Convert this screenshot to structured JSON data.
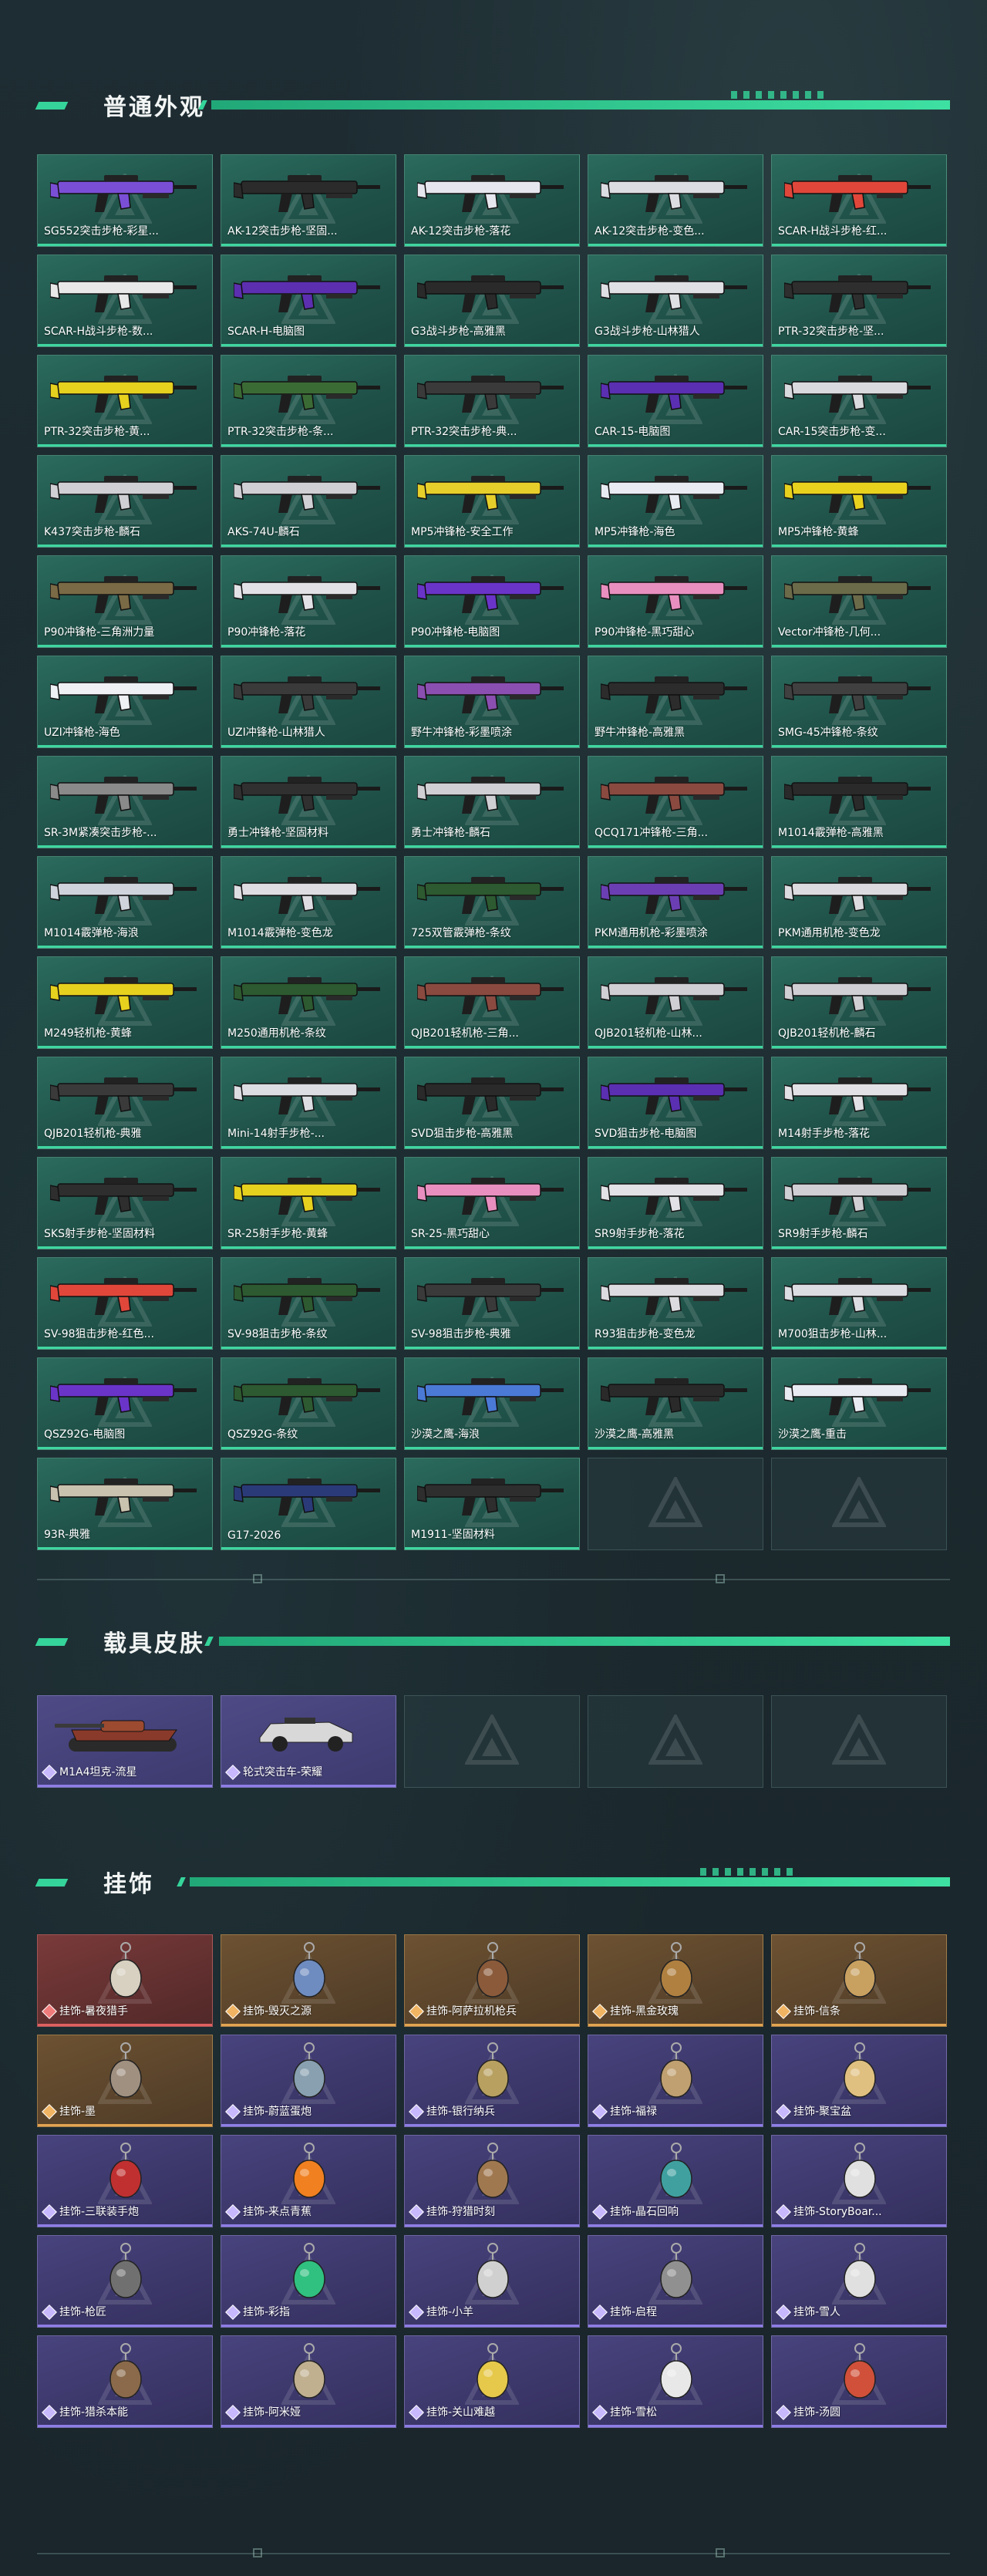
{
  "sections": {
    "weapons_title": "普通外观",
    "vehicles_title": "载具皮肤",
    "charms_title": "挂饰"
  },
  "weapons": [
    {
      "label": "SG552突击步枪-彩星...",
      "color": "#7a4fd6"
    },
    {
      "label": "AK-12突击步枪-坚固...",
      "color": "#2b2b2b"
    },
    {
      "label": "AK-12突击步枪-落花",
      "color": "#e6e6ee"
    },
    {
      "label": "AK-12突击步枪-变色...",
      "color": "#dcdde2"
    },
    {
      "label": "SCAR-H战斗步枪-红...",
      "color": "#e0473a"
    },
    {
      "label": "SCAR-H战斗步枪-数...",
      "color": "#e8e8e8"
    },
    {
      "label": "SCAR-H-电脑图",
      "color": "#5b2fb0"
    },
    {
      "label": "G3战斗步枪-高雅黑",
      "color": "#2a2a2a"
    },
    {
      "label": "G3战斗步枪-山林猎人",
      "color": "#dfe0e4"
    },
    {
      "label": "PTR-32突击步枪-坚...",
      "color": "#2e2e2e"
    },
    {
      "label": "PTR-32突击步枪-黄...",
      "color": "#e5d11e"
    },
    {
      "label": "PTR-32突击步枪-条...",
      "color": "#3b6b35"
    },
    {
      "label": "PTR-32突击步枪-典...",
      "color": "#3a3a3a"
    },
    {
      "label": "CAR-15-电脑图",
      "color": "#5a2fb2"
    },
    {
      "label": "CAR-15突击步枪-变...",
      "color": "#d9dade"
    },
    {
      "label": "K437突击步枪-麟石",
      "color": "#cfcfd4"
    },
    {
      "label": "AKS-74U-麟石",
      "color": "#cfcfd4"
    },
    {
      "label": "MP5冲锋枪-安全工作",
      "color": "#e6cf2a"
    },
    {
      "label": "MP5冲锋枪-海色",
      "color": "#e8ecf2"
    },
    {
      "label": "MP5冲锋枪-黄蜂",
      "color": "#e8d21e"
    },
    {
      "label": "P90冲锋枪-三角洲力量",
      "color": "#7a6a45"
    },
    {
      "label": "P90冲锋枪-落花",
      "color": "#e2e2e6"
    },
    {
      "label": "P90冲锋枪-电脑图",
      "color": "#6a34c9"
    },
    {
      "label": "P90冲锋枪-黑巧甜心",
      "color": "#e88fbf"
    },
    {
      "label": "Vector冲锋枪-几何...",
      "color": "#6b6b4a"
    },
    {
      "label": "UZI冲锋枪-海色",
      "color": "#eef0f4"
    },
    {
      "label": "UZI冲锋枪-山林猎人",
      "color": "#3a3a3a"
    },
    {
      "label": "野牛冲锋枪-彩墨喷涂",
      "color": "#8a4fb0"
    },
    {
      "label": "野牛冲锋枪-高雅黑",
      "color": "#2c2c2c"
    },
    {
      "label": "SMG-45冲锋枪-条纹",
      "color": "#404040"
    },
    {
      "label": "SR-3M紧凑突击步枪-...",
      "color": "#8a8a8a"
    },
    {
      "label": "勇士冲锋枪-坚固材料",
      "color": "#303030"
    },
    {
      "label": "勇士冲锋枪-麟石",
      "color": "#cfcfd4"
    },
    {
      "label": "QCQ171冲锋枪-三角...",
      "color": "#8a4a40"
    },
    {
      "label": "M1014霰弹枪-高雅黑",
      "color": "#2a2a2a"
    },
    {
      "label": "M1014霰弹枪-海浪",
      "color": "#cfd4dc"
    },
    {
      "label": "M1014霰弹枪-变色龙",
      "color": "#dddde2"
    },
    {
      "label": "725双管霰弹枪-条纹",
      "color": "#2d5a30"
    },
    {
      "label": "PKM通用机枪-彩墨喷涂",
      "color": "#6b3fb3"
    },
    {
      "label": "PKM通用机枪-变色龙",
      "color": "#dcdce0"
    },
    {
      "label": "M249轻机枪-黄蜂",
      "color": "#e6d11e"
    },
    {
      "label": "M250通用机枪-条纹",
      "color": "#2d5a30"
    },
    {
      "label": "QJB201轻机枪-三角...",
      "color": "#8a4a40"
    },
    {
      "label": "QJB201轻机枪-山林...",
      "color": "#cfcfd4"
    },
    {
      "label": "QJB201轻机枪-麟石",
      "color": "#cfcfd4"
    },
    {
      "label": "QJB201轻机枪-典雅",
      "color": "#3a3a3a"
    },
    {
      "label": "Mini-14射手步枪-...",
      "color": "#dcdde2"
    },
    {
      "label": "SVD狙击步枪-高雅黑",
      "color": "#2a2a2a"
    },
    {
      "label": "SVD狙击步枪-电脑图",
      "color": "#5a2fb2"
    },
    {
      "label": "M14射手步枪-落花",
      "color": "#e2e2e6"
    },
    {
      "label": "SKS射手步枪-坚固材料",
      "color": "#2e2e2e"
    },
    {
      "label": "SR-25射手步枪-黄蜂",
      "color": "#e6d11e"
    },
    {
      "label": "SR-25-黑巧甜心",
      "color": "#e88fbf"
    },
    {
      "label": "SR9射手步枪-落花",
      "color": "#e2e2e6"
    },
    {
      "label": "SR9射手步枪-麟石",
      "color": "#cfcfd4"
    },
    {
      "label": "SV-98狙击步枪-红色...",
      "color": "#e0473a"
    },
    {
      "label": "SV-98狙击步枪-条纹",
      "color": "#2d5a30"
    },
    {
      "label": "SV-98狙击步枪-典雅",
      "color": "#3a3a3a"
    },
    {
      "label": "R93狙击步枪-变色龙",
      "color": "#dcdce0"
    },
    {
      "label": "M700狙击步枪-山林...",
      "color": "#dcdde2"
    },
    {
      "label": "QSZ92G-电脑图",
      "color": "#6a34c9"
    },
    {
      "label": "QSZ92G-条纹",
      "color": "#2d5a30"
    },
    {
      "label": "沙漠之鹰-海浪",
      "color": "#4a7ad6"
    },
    {
      "label": "沙漠之鹰-高雅黑",
      "color": "#2a2a2a"
    },
    {
      "label": "沙漠之鹰-重击",
      "color": "#e8ecf2"
    },
    {
      "label": "93R-典雅",
      "color": "#c9c2ae"
    },
    {
      "label": "G17-2026",
      "color": "#2a3a78"
    },
    {
      "label": "M1911-坚固材料",
      "color": "#2e2e2e"
    }
  ],
  "vehicles": [
    {
      "label": "M1A4坦克-流星"
    },
    {
      "label": "轮式突击车-荣耀"
    }
  ],
  "charms": [
    {
      "label": "挂饰-暑夜猎手",
      "tier": "red"
    },
    {
      "label": "挂饰-毁灭之源",
      "tier": "gold"
    },
    {
      "label": "挂饰-阿萨拉机枪兵",
      "tier": "gold"
    },
    {
      "label": "挂饰-黑金玫瑰",
      "tier": "gold"
    },
    {
      "label": "挂饰-信条",
      "tier": "gold"
    },
    {
      "label": "挂饰-墨",
      "tier": "gold"
    },
    {
      "label": "挂饰-蔚蓝蛋炮",
      "tier": "purple"
    },
    {
      "label": "挂饰-银行纳兵",
      "tier": "purple"
    },
    {
      "label": "挂饰-福禄",
      "tier": "purple"
    },
    {
      "label": "挂饰-聚宝盆",
      "tier": "purple"
    },
    {
      "label": "挂饰-三联装手炮",
      "tier": "purple"
    },
    {
      "label": "挂饰-来点青蕉",
      "tier": "purple"
    },
    {
      "label": "挂饰-狩猎时刻",
      "tier": "purple"
    },
    {
      "label": "挂饰-晶石回响",
      "tier": "purple"
    },
    {
      "label": "挂饰-StoryBoar...",
      "tier": "purple"
    },
    {
      "label": "挂饰-枪匠",
      "tier": "purple"
    },
    {
      "label": "挂饰-彩指",
      "tier": "purple"
    },
    {
      "label": "挂饰-小羊",
      "tier": "purple"
    },
    {
      "label": "挂饰-启程",
      "tier": "purple"
    },
    {
      "label": "挂饰-雪人",
      "tier": "purple"
    },
    {
      "label": "挂饰-猎杀本能",
      "tier": "purple"
    },
    {
      "label": "挂饰-阿米娅",
      "tier": "purple"
    },
    {
      "label": "挂饰-关山难越",
      "tier": "purple"
    },
    {
      "label": "挂饰-雪松",
      "tier": "purple"
    },
    {
      "label": "挂饰-汤圆",
      "tier": "purple"
    }
  ]
}
